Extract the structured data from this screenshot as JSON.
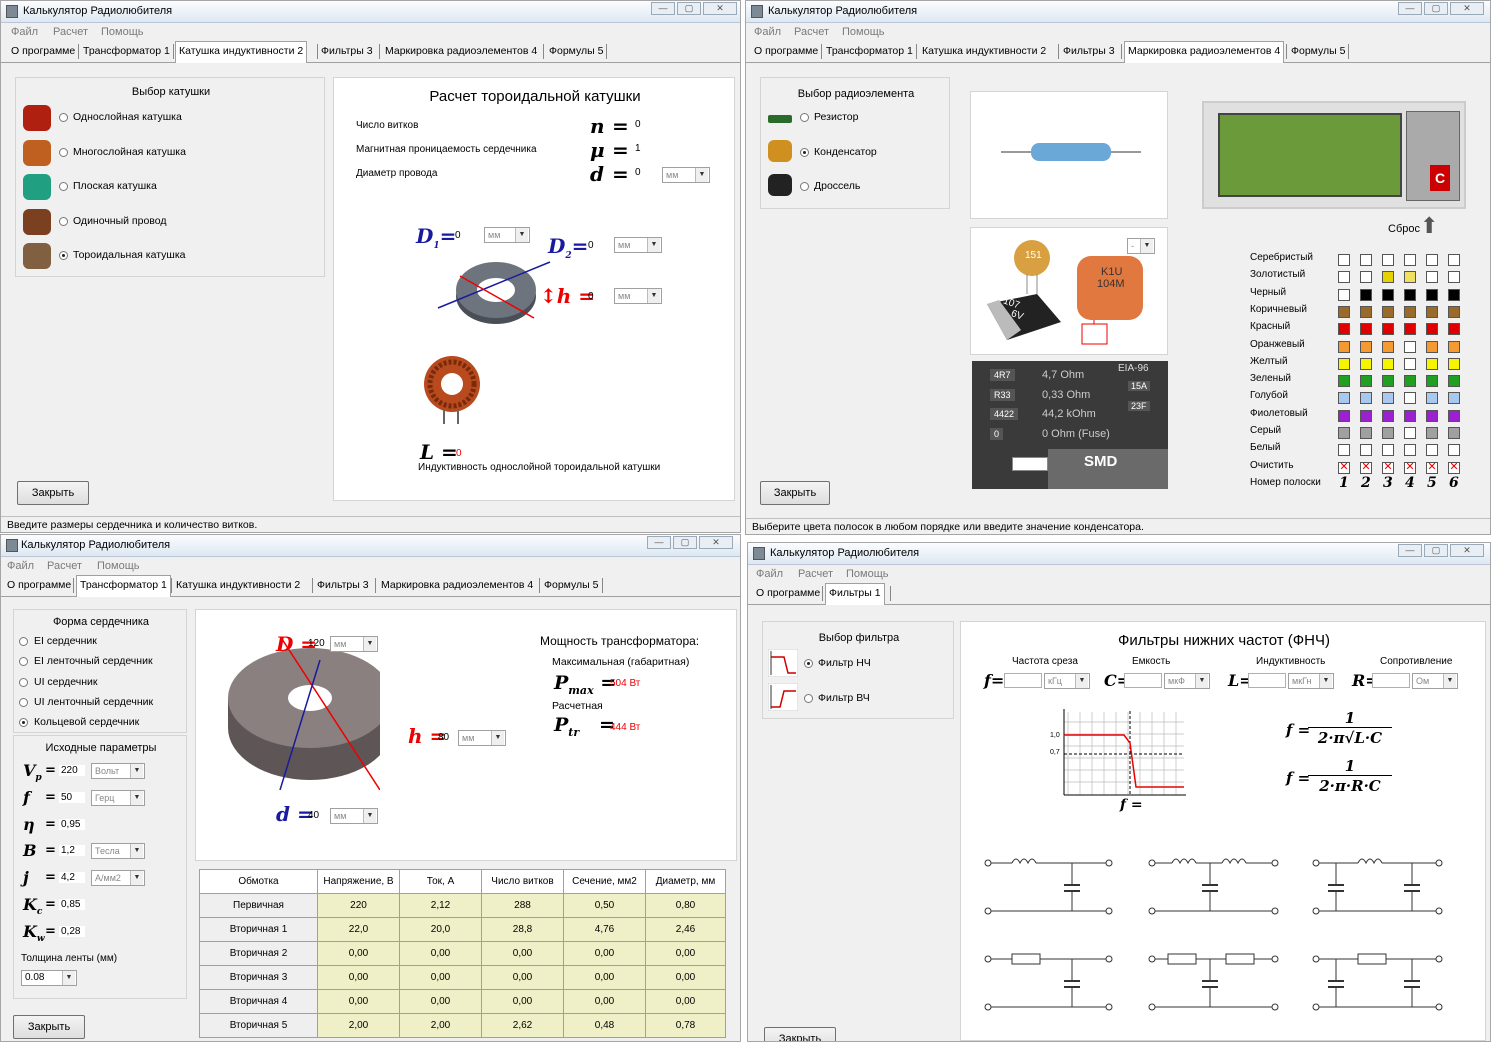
{
  "app_title": "Калькулятор Радиолюбителя",
  "menu": [
    "Файл",
    "Расчет",
    "Помощь"
  ],
  "tabs": [
    "О программе",
    "Трансформатор 1",
    "Катушка индуктивности 2",
    "Фильтры 3",
    "Маркировка радиоэлементов 4",
    "Формулы 5"
  ],
  "tabs4": [
    "О программе",
    "Фильтры 1"
  ],
  "close_label": "Закрыть",
  "w1": {
    "group_title": "Выбор катушки",
    "coils": [
      "Однослойная катушка",
      "Многослойная катушка",
      "Плоская катушка",
      "Одиночный провод",
      "Тороидальная катушка"
    ],
    "selected": 4,
    "title": "Расчет тороидальной катушки",
    "params": [
      {
        "label": "Число витков",
        "sym": "n",
        "val": "0"
      },
      {
        "label": "Магнитная проницаемость сердечника",
        "sym": "μ",
        "val": "1"
      },
      {
        "label": "Диаметр провода",
        "sym": "d",
        "val": "0",
        "unit": "мм"
      }
    ],
    "d1": "D",
    "d1sub": "1",
    "d1val": "0",
    "d2": "D",
    "d2sub": "2",
    "d2val": "0",
    "h": "h",
    "hval": "0",
    "unit": "мм",
    "L": "L",
    "Lval": "0",
    "L_caption": "Индуктивность однослойной тороидальной катушки",
    "status": "Введите размеры сердечника и количество витков."
  },
  "w2": {
    "group_title": "Выбор радиоэлемента",
    "elements": [
      "Резистор",
      "Конденсатор",
      "Дроссель"
    ],
    "selected": 1,
    "cap_select": "-",
    "reset": "Сброс",
    "smd_codes": [
      "4R7",
      "R33",
      "4422",
      "0"
    ],
    "smd_values": [
      "4,7 Ohm",
      "0,33 Ohm",
      "44,2 kOhm",
      "0 Ohm (Fuse)"
    ],
    "eia": "EIA-96",
    "eia_codes": [
      "15A",
      "23F"
    ],
    "smd": "SMD",
    "cap_text1": "151",
    "cap_text2": "107",
    "cap_text3": "6V",
    "cap_text4": "K1U",
    "cap_text5": "104M",
    "colors": [
      {
        "name": "Серебристый",
        "hex": "#ffffff"
      },
      {
        "name": "Золотистый",
        "hex": "#e6d200"
      },
      {
        "name": "Черный",
        "hex": "#000000"
      },
      {
        "name": "Коричневый",
        "hex": "#9a6a2a"
      },
      {
        "name": "Красный",
        "hex": "#e00000"
      },
      {
        "name": "Оранжевый",
        "hex": "#f59a30"
      },
      {
        "name": "Желтый",
        "hex": "#f5f500"
      },
      {
        "name": "Зеленый",
        "hex": "#20a020"
      },
      {
        "name": "Голубой",
        "hex": "#a8c8f0"
      },
      {
        "name": "Фиолетовый",
        "hex": "#9a20d0"
      },
      {
        "name": "Серый",
        "hex": "#a0a0a0"
      },
      {
        "name": "Белый",
        "hex": "#ffffff"
      }
    ],
    "clear": "Очистить",
    "band_label": "Номер полоски",
    "bands": [
      "1",
      "2",
      "3",
      "4",
      "5",
      "6"
    ],
    "status": "Выберите цвета полосок в любом порядке или введите значение конденсатора."
  },
  "w3": {
    "group_title": "Форма сердечника",
    "cores": [
      "EI сердечник",
      "EI ленточный сердечник",
      "UI сердечник",
      "UI ленточный сердечник",
      "Кольцевой сердечник"
    ],
    "selected": 4,
    "params_title": "Исходные параметры",
    "params": [
      {
        "sym": "V",
        "sub": "p",
        "val": "220",
        "unit": "Вольт"
      },
      {
        "sym": "f",
        "sub": "",
        "val": "50",
        "unit": "Герц"
      },
      {
        "sym": "η",
        "sub": "",
        "val": "0,95",
        "unit": ""
      },
      {
        "sym": "B",
        "sub": "",
        "val": "1,2",
        "unit": "Тесла"
      },
      {
        "sym": "j",
        "sub": "",
        "val": "4,2",
        "unit": "А/мм2"
      },
      {
        "sym": "K",
        "sub": "c",
        "val": "0,85",
        "unit": ""
      },
      {
        "sym": "K",
        "sub": "w",
        "val": "0,28",
        "unit": ""
      }
    ],
    "tape_label": "Толщина ленты (мм)",
    "tape_val": "0.08",
    "D": "D",
    "Dval": "120",
    "h": "h",
    "hval": "80",
    "d": "d",
    "dval": "40",
    "unit": "мм",
    "power_title": "Мощность трансформатора:",
    "pmax_label": "Максимальная (габаритная)",
    "pmax_sym": "P",
    "pmax_sub": "max",
    "pmax_val": "504 Вт",
    "ptr_label": "Расчетная",
    "ptr_sym": "P",
    "ptr_sub": "tr",
    "ptr_val": "444 Вт",
    "table_headers": [
      "Обмотка",
      "Напряжение, В",
      "Ток, А",
      "Число витков",
      "Сечение, мм2",
      "Диаметр, мм"
    ],
    "table_rows": [
      [
        "Первичная",
        "220",
        "2,12",
        "288",
        "0,50",
        "0,80"
      ],
      [
        "Вторичная 1",
        "22,0",
        "20,0",
        "28,8",
        "4,76",
        "2,46"
      ],
      [
        "Вторичная 2",
        "0,00",
        "0,00",
        "0,00",
        "0,00",
        "0,00"
      ],
      [
        "Вторичная 3",
        "0,00",
        "0,00",
        "0,00",
        "0,00",
        "0,00"
      ],
      [
        "Вторичная 4",
        "0,00",
        "0,00",
        "0,00",
        "0,00",
        "0,00"
      ],
      [
        "Вторичная 5",
        "2,00",
        "2,00",
        "2,62",
        "0,48",
        "0,78"
      ]
    ]
  },
  "w4": {
    "group_title": "Выбор фильтра",
    "filters": [
      "Фильтр НЧ",
      "Фильтр ВЧ"
    ],
    "selected": 0,
    "title": "Фильтры нижних частот (ФНЧ)",
    "cols": [
      {
        "label": "Частота среза",
        "sym": "f",
        "unit": "кГц"
      },
      {
        "label": "Емкость",
        "sym": "C",
        "unit": "мкФ"
      },
      {
        "label": "Индуктивность",
        "sym": "L",
        "unit": "мкГн"
      },
      {
        "label": "Сопротивление",
        "sym": "R",
        "unit": "Ом"
      }
    ],
    "graph_y1": "1,0",
    "graph_y2": "0,7",
    "graph_f": "f =",
    "formula1_num": "1",
    "formula1_den": "2·π√L·C",
    "formula2_num": "1",
    "formula2_den": "2·π·R·C",
    "formula_lhs": "f ="
  }
}
